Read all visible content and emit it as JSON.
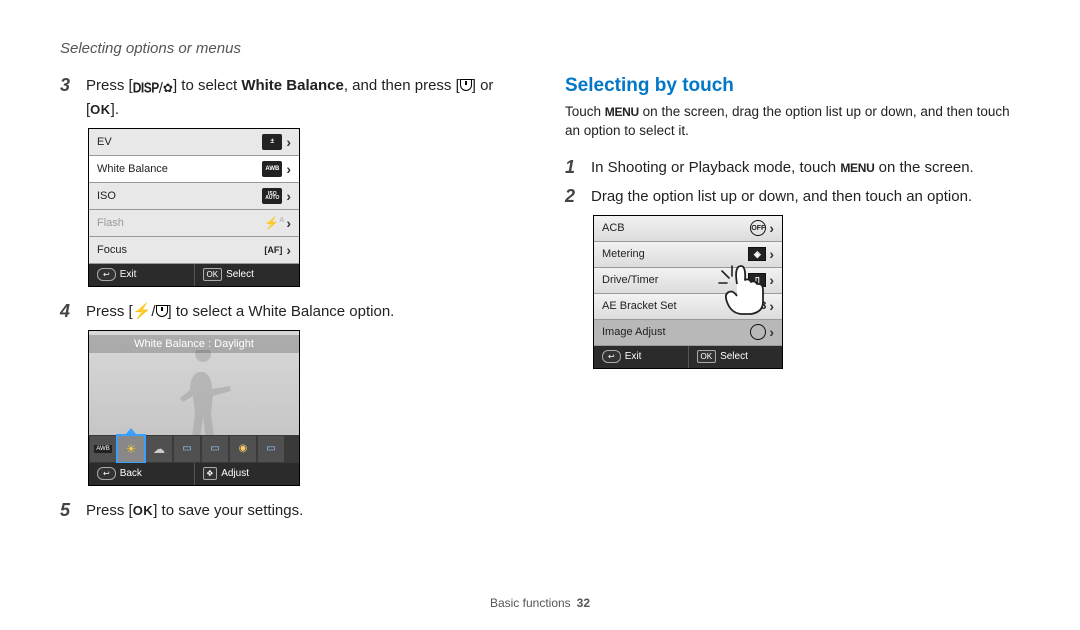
{
  "header": "Selecting options or menus",
  "footer": {
    "section": "Basic functions",
    "page": "32"
  },
  "left": {
    "step3": {
      "num": "3",
      "pre": "Press [",
      "btn1a": "DISP",
      "btn1b_icon": "flower",
      "mid": "] to select ",
      "bold": "White Balance",
      "post1": ", and then press [",
      "btn2_icon": "timer",
      "post2": "] or [",
      "btn3": "OK",
      "end": "]."
    },
    "menu1": {
      "rows": [
        {
          "label": "EV",
          "icon": "±",
          "selected": false,
          "dim": false
        },
        {
          "label": "White Balance",
          "icon": "AWB",
          "selected": true,
          "dim": false
        },
        {
          "label": "ISO",
          "icon": "ISO",
          "selected": false,
          "dim": false
        },
        {
          "label": "Flash",
          "icon": "⚡A",
          "selected": false,
          "dim": true
        },
        {
          "label": "Focus",
          "icon": "[AF]",
          "selected": false,
          "dim": false
        }
      ],
      "bar": {
        "left_btn": "↩",
        "left_label": "Exit",
        "right_btn": "OK",
        "right_label": "Select"
      }
    },
    "step4": {
      "num": "4",
      "pre": "Press [",
      "btn_a_icon": "flash",
      "btn_b_icon": "timer",
      "post": "] to select a White Balance option."
    },
    "wb_screen": {
      "title": "White Balance : Daylight",
      "bar": {
        "left_btn": "↩",
        "left_label": "Back",
        "right_btn": "✥",
        "right_label": "Adjust"
      }
    },
    "step5": {
      "num": "5",
      "pre": "Press [",
      "btn": "OK",
      "post": "] to save your settings."
    }
  },
  "right": {
    "title": "Selecting by touch",
    "intro_pre": "Touch ",
    "intro_btn": "MENU",
    "intro_post": " on the screen, drag the option list up or down, and then touch an option to select it.",
    "step1": {
      "num": "1",
      "pre": "In Shooting or Playback mode, touch ",
      "btn": "MENU",
      "post": " on the screen."
    },
    "step2": {
      "num": "2",
      "text": "Drag the option list up or down, and then touch an option."
    },
    "menu2": {
      "rows": [
        {
          "label": "ACB",
          "icon_type": "circle",
          "icon_text": "OFF"
        },
        {
          "label": "Metering",
          "icon_type": "rect",
          "icon_text": "◈"
        },
        {
          "label": "Drive/Timer",
          "icon_type": "rect",
          "icon_text": "▯"
        },
        {
          "label": "AE Bracket Set",
          "icon_type": "text",
          "icon_text": ".3"
        },
        {
          "label": "Image Adjust",
          "icon_type": "circle",
          "icon_text": ""
        }
      ],
      "bar": {
        "left_btn": "↩",
        "left_label": "Exit",
        "right_btn": "OK",
        "right_label": "Select"
      }
    }
  }
}
